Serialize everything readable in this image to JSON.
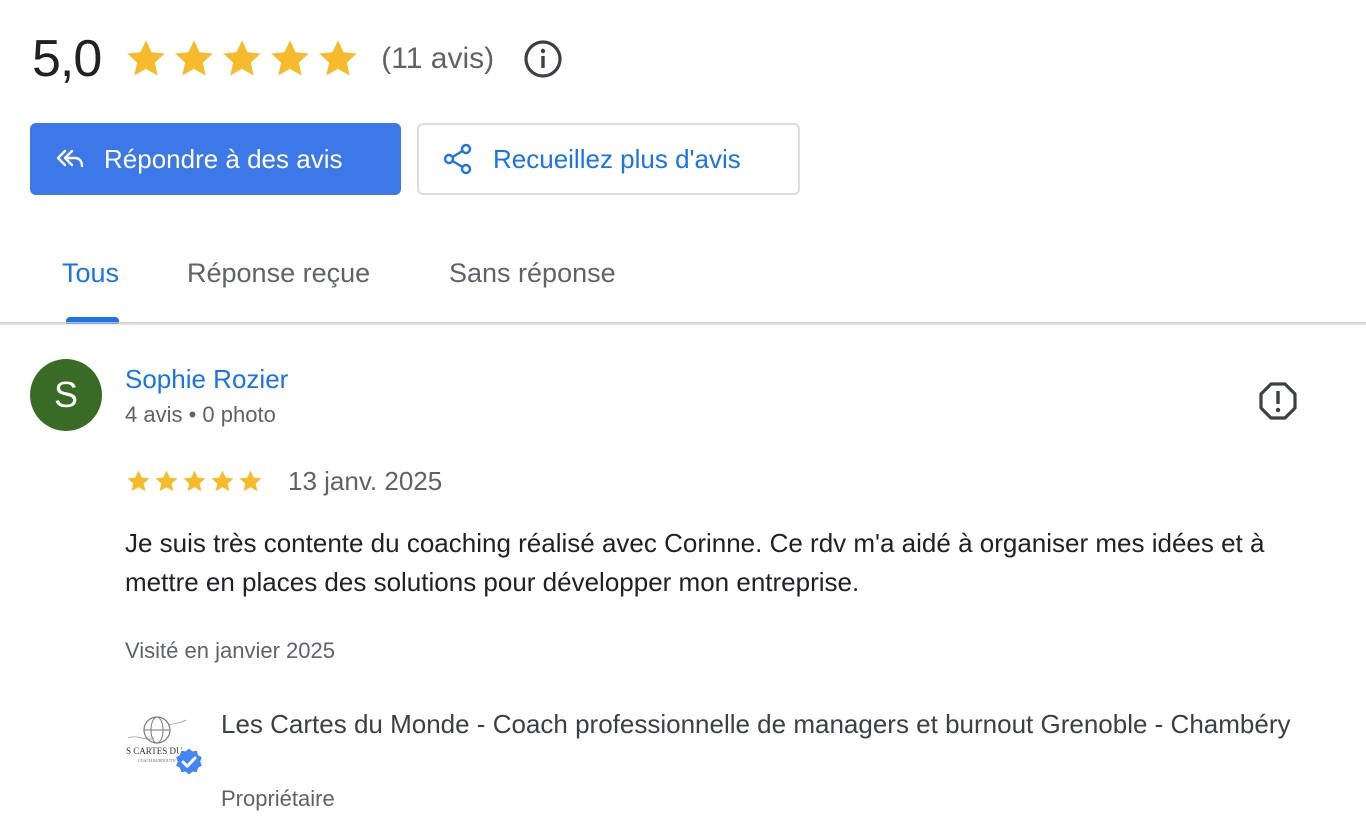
{
  "summary": {
    "score": "5,0",
    "star_count": 5,
    "review_count": "(11 avis)",
    "star_color": "#f6bb2a"
  },
  "actions": {
    "reply_label": "Répondre à des avis",
    "collect_label": "Recueillez plus d'avis",
    "accent_color": "#1a73e8"
  },
  "tabs": [
    {
      "label": "Tous",
      "active": true
    },
    {
      "label": "Réponse reçue",
      "active": false
    },
    {
      "label": "Sans réponse",
      "active": false
    }
  ],
  "review": {
    "avatar_letter": "S",
    "avatar_color": "#3a6b24",
    "author": "Sophie Rozier",
    "author_meta": "4 avis • 0 photo",
    "rating": 5,
    "date": "13 janv. 2025",
    "text": "Je suis très contente du coaching réalisé avec Corinne. Ce rdv m'a aidé à organiser mes idées et à mettre en places des solutions pour développer mon entreprise.",
    "visited": "Visité en janvier 2025"
  },
  "owner": {
    "logo_text": "S CARTES DU",
    "name": "Les Cartes du Monde - Coach professionnelle de managers et burnout Grenoble - Chambéry",
    "role": "Propriétaire"
  },
  "icons": {
    "info": "info-icon",
    "reply": "reply-all-icon",
    "share": "share-icon",
    "flag": "report-icon",
    "verified": "verified-badge-icon"
  }
}
